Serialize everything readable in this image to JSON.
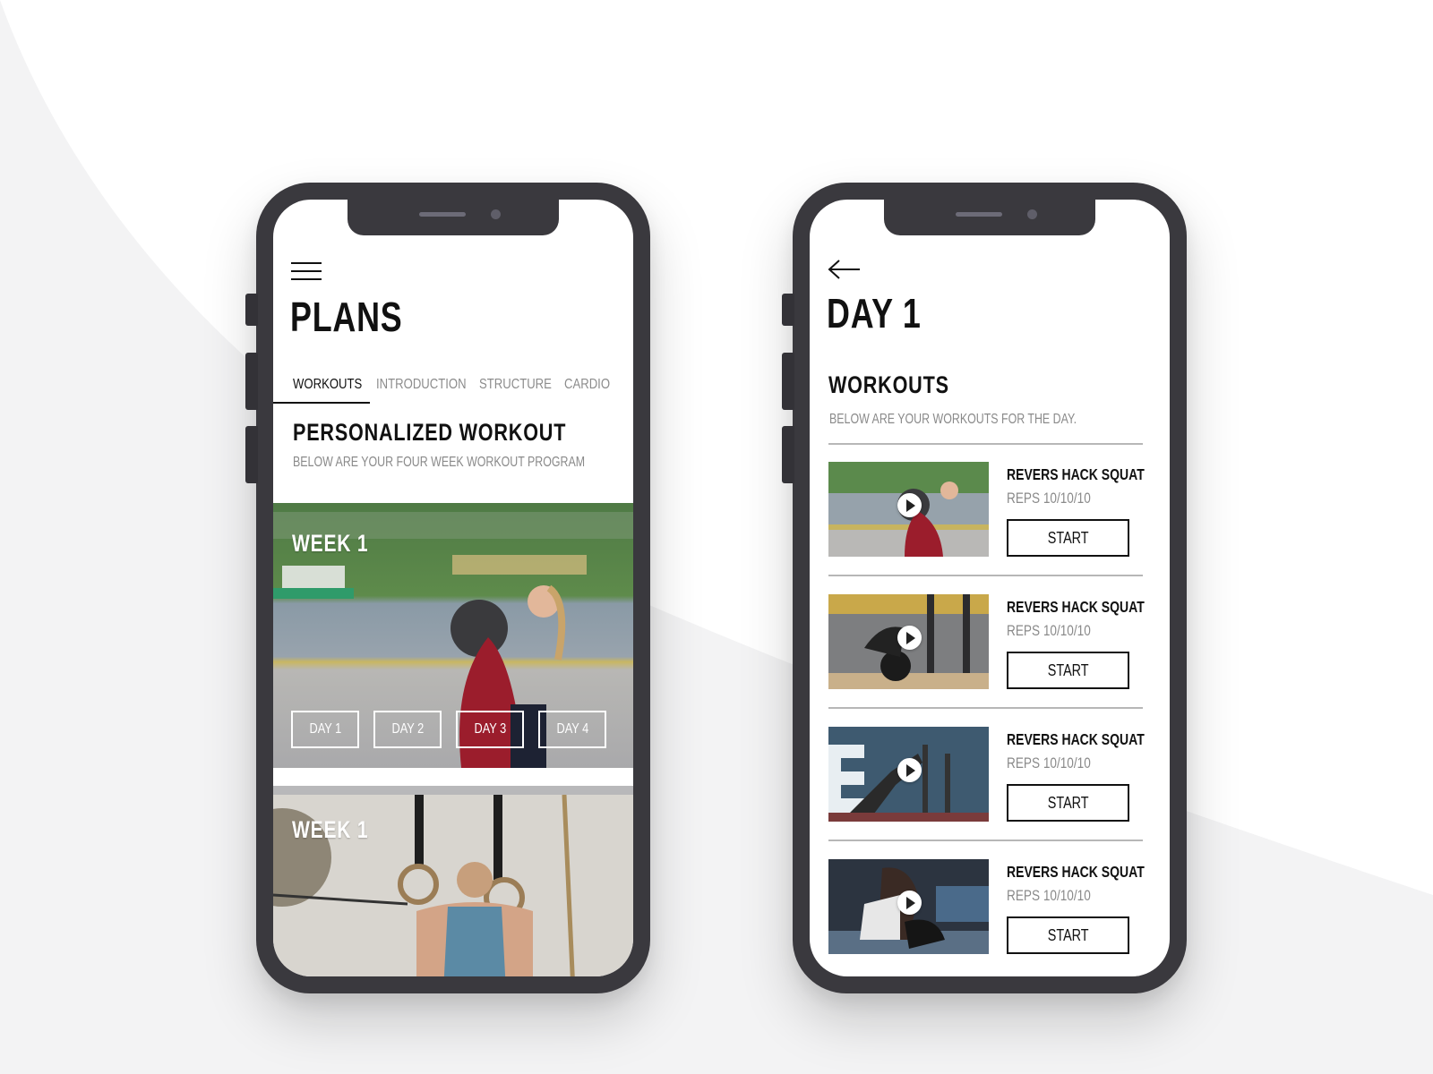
{
  "colors": {
    "background": "#f6f6f7",
    "phone_frame": "#3a393e",
    "text_primary": "#111111",
    "text_secondary": "#8a8a8a",
    "divider": "#b7b7b7"
  },
  "left_screen": {
    "menu_icon": "hamburger-menu-icon",
    "title": "PLANS",
    "tabs": [
      {
        "label": "WORKOUTS",
        "active": true
      },
      {
        "label": "INTRODUCTION",
        "active": false
      },
      {
        "label": "STRUCTURE",
        "active": false
      },
      {
        "label": "CARDIO",
        "active": false
      }
    ],
    "section_title": "PERSONALIZED WORKOUT",
    "section_subtitle": "BELOW ARE YOUR FOUR WEEK WORKOUT PROGRAM",
    "weeks": [
      {
        "label": "WEEK 1",
        "image": "woman lifting medicine ball by waterfront",
        "days": [
          "DAY 1",
          "DAY 2",
          "DAY 3",
          "DAY 4"
        ]
      },
      {
        "label": "WEEK 1",
        "image": "woman hanging on gymnastic rings"
      }
    ]
  },
  "right_screen": {
    "back_icon": "arrow-left-icon",
    "title": "DAY 1",
    "section_title": "WORKOUTS",
    "section_subtitle": "BELOW ARE YOUR WORKOUTS FOR THE DAY.",
    "workouts": [
      {
        "name": "REVERS HACK SQUAT",
        "reps": "REPS 10/10/10",
        "button": "START",
        "image": "medicine ball lift outdoors"
      },
      {
        "name": "REVERS HACK SQUAT",
        "reps": "REPS 10/10/10",
        "button": "START",
        "image": "barbell deadlift in gym"
      },
      {
        "name": "REVERS HACK SQUAT",
        "reps": "REPS 10/10/10",
        "button": "START",
        "image": "sled push in gym"
      },
      {
        "name": "REVERS HACK SQUAT",
        "reps": "REPS 10/10/10",
        "button": "START",
        "image": "stretching on gym floor"
      }
    ]
  }
}
